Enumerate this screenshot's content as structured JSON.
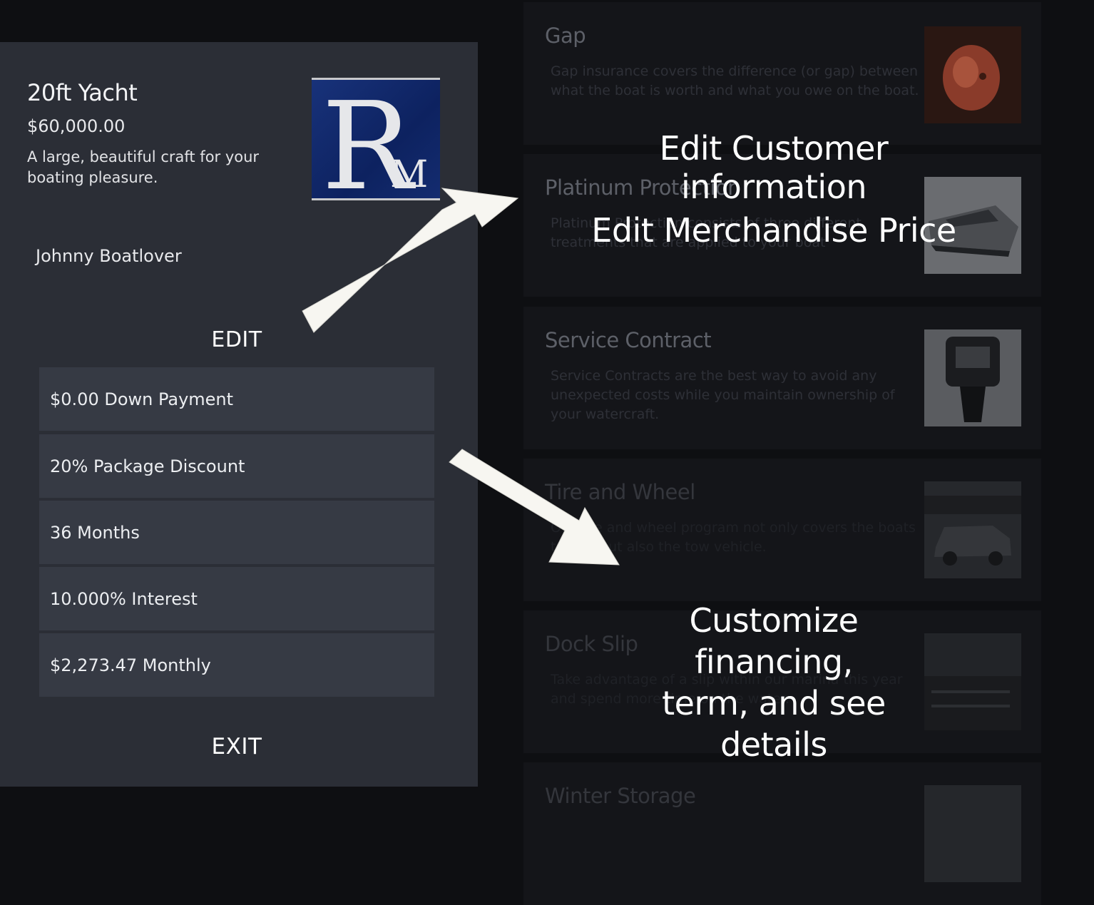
{
  "products": [
    {
      "title": "Gap",
      "description": "Gap insurance covers the difference (or gap) between what the boat is worth and what you owe on the boat.",
      "image_icon": "piggy-bank-icon"
    },
    {
      "title": "Platinum Protection",
      "description": "Platinum Protection consists of three different treatments that are applied to your boat",
      "image_icon": "speedboat-icon"
    },
    {
      "title": "Service Contract",
      "description": "Service Contracts are the best way to avoid any unexpected costs while you maintain ownership of your watercraft.",
      "image_icon": "outboard-motor-icon"
    },
    {
      "title": "Tire and Wheel",
      "description": "Our tire and wheel program not only covers the boats trailer, but also the tow vehicle.",
      "image_icon": "truck-icon"
    },
    {
      "title": "Dock Slip",
      "description": "Take advantage of a slip within our marina this year and spend more time on the water.",
      "image_icon": "marina-icon"
    },
    {
      "title": "Winter Storage",
      "description": "",
      "image_icon": "storage-icon"
    }
  ],
  "panel": {
    "item_title": "20ft Yacht",
    "item_price": "$60,000.00",
    "item_description": "A large, beautiful craft for your boating pleasure.",
    "logo_text": "RM",
    "customer_name": "Johnny Boatlover",
    "edit_label": "EDIT",
    "financing_rows": [
      {
        "label": "$0.00 Down Payment"
      },
      {
        "label": "20% Package Discount"
      },
      {
        "label": "36 Months"
      },
      {
        "label": "10.000% Interest"
      },
      {
        "label": "$2,273.47 Monthly"
      }
    ],
    "exit_label": "EXIT"
  },
  "annotations": {
    "edit_customer": "Edit Customer information",
    "edit_price": "Edit Merchandise Price",
    "customize_line1": "Customize financing,",
    "customize_line2": "term, and see details"
  },
  "colors": {
    "background": "#0e0f12",
    "panel": "#2b2e36",
    "row": "#363a44",
    "logo_blue": "#0d2260"
  }
}
